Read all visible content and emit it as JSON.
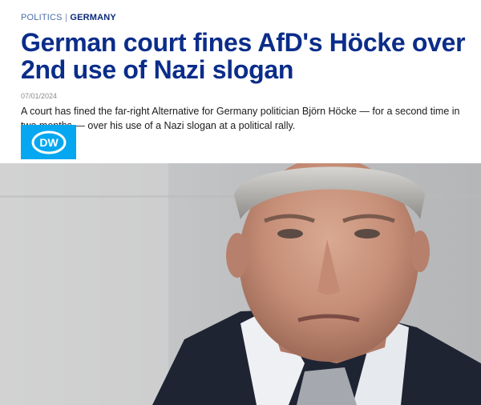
{
  "article": {
    "section": "POLITICS",
    "separator": "|",
    "subsection": "GERMANY",
    "headline": "German court fines AfD's Höcke over 2nd use of Nazi slogan",
    "date": "07/01/2024",
    "dek": "A court has fined the far-right Alternative for Germany politician Björn Höcke — for a second time in two months — over his use of a Nazi slogan at a political rally."
  },
  "source_logo": {
    "text": "DW",
    "icon": "dw-logo-icon",
    "color": "#05a7f0"
  },
  "photo": {
    "icon": "photo-portrait"
  },
  "colors": {
    "headline": "#0b2d8a",
    "kicker": "#4a6fa5"
  }
}
